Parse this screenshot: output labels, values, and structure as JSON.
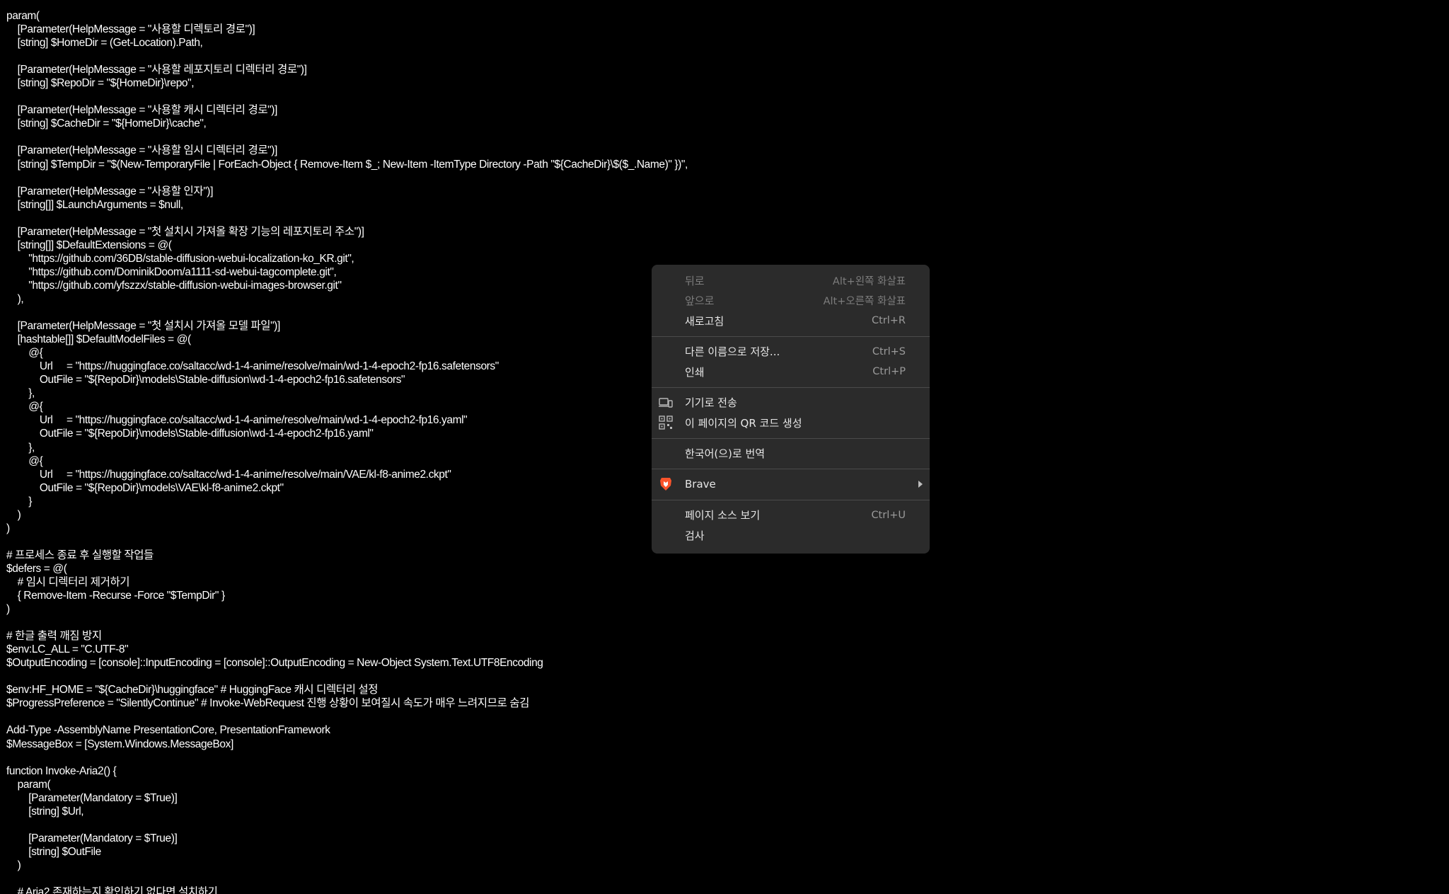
{
  "code_lines": [
    "param(",
    "    [Parameter(HelpMessage = \"사용할 디렉토리 경로\")]",
    "    [string] $HomeDir = (Get-Location).Path,",
    "",
    "    [Parameter(HelpMessage = \"사용할 레포지토리 디렉터리 경로\")]",
    "    [string] $RepoDir = \"${HomeDir}\\repo\",",
    "",
    "    [Parameter(HelpMessage = \"사용할 캐시 디렉터리 경로\")]",
    "    [string] $CacheDir = \"${HomeDir}\\cache\",",
    "",
    "    [Parameter(HelpMessage = \"사용할 임시 디렉터리 경로\")]",
    "    [string] $TempDir = \"$(New-TemporaryFile | ForEach-Object { Remove-Item $_; New-Item -ItemType Directory -Path \"${CacheDir}\\$($_.Name)\" })\",",
    "",
    "    [Parameter(HelpMessage = \"사용할 인자\")]",
    "    [string[]] $LaunchArguments = $null,",
    "",
    "    [Parameter(HelpMessage = \"첫 설치시 가져올 확장 기능의 레포지토리 주소\")]",
    "    [string[]] $DefaultExtensions = @(",
    "        \"https://github.com/36DB/stable-diffusion-webui-localization-ko_KR.git\",",
    "        \"https://github.com/DominikDoom/a1111-sd-webui-tagcomplete.git\",",
    "        \"https://github.com/yfszzx/stable-diffusion-webui-images-browser.git\"",
    "    ),",
    "",
    "    [Parameter(HelpMessage = \"첫 설치시 가져올 모델 파일\")]",
    "    [hashtable[]] $DefaultModelFiles = @(",
    "        @{",
    "            Url     = \"https://huggingface.co/saltacc/wd-1-4-anime/resolve/main/wd-1-4-epoch2-fp16.safetensors\"",
    "            OutFile = \"${RepoDir}\\models\\Stable-diffusion\\wd-1-4-epoch2-fp16.safetensors\"",
    "        },",
    "        @{",
    "            Url     = \"https://huggingface.co/saltacc/wd-1-4-anime/resolve/main/wd-1-4-epoch2-fp16.yaml\"",
    "            OutFile = \"${RepoDir}\\models\\Stable-diffusion\\wd-1-4-epoch2-fp16.yaml\"",
    "        },",
    "        @{",
    "            Url     = \"https://huggingface.co/saltacc/wd-1-4-anime/resolve/main/VAE/kl-f8-anime2.ckpt\"",
    "            OutFile = \"${RepoDir}\\models\\VAE\\kl-f8-anime2.ckpt\"",
    "        }",
    "    )",
    ")",
    "",
    "# 프로세스 종료 후 실행할 작업들",
    "$defers = @(",
    "    # 임시 디렉터리 제거하기",
    "    { Remove-Item -Recurse -Force \"$TempDir\" }",
    ")",
    "",
    "# 한글 출력 깨짐 방지",
    "$env:LC_ALL = \"C.UTF-8\"",
    "$OutputEncoding = [console]::InputEncoding = [console]::OutputEncoding = New-Object System.Text.UTF8Encoding",
    "",
    "$env:HF_HOME = \"${CacheDir}\\huggingface\" # HuggingFace 캐시 디렉터리 설정",
    "$ProgressPreference = \"SilentlyContinue\" # Invoke-WebRequest 진행 상황이 보여질시 속도가 매우 느려지므로 숨김",
    "",
    "Add-Type -AssemblyName PresentationCore, PresentationFramework",
    "$MessageBox = [System.Windows.MessageBox]",
    "",
    "function Invoke-Aria2() {",
    "    param(",
    "        [Parameter(Mandatory = $True)]",
    "        [string] $Url,",
    "",
    "        [Parameter(Mandatory = $True)]",
    "        [string] $OutFile",
    "    )",
    "",
    "    # Aria2 존재하는지 확인하기 없다면 설치하기"
  ],
  "menu": {
    "back": {
      "label": "뒤로",
      "shortcut": "Alt+왼쪽 화살표"
    },
    "forward": {
      "label": "앞으로",
      "shortcut": "Alt+오른쪽 화살표"
    },
    "reload": {
      "label": "새로고침",
      "shortcut": "Ctrl+R"
    },
    "save_as": {
      "label": "다른 이름으로 저장...",
      "shortcut": "Ctrl+S"
    },
    "print": {
      "label": "인쇄",
      "shortcut": "Ctrl+P"
    },
    "send_to_devices": {
      "label": "기기로 전송",
      "icon": "devices-icon"
    },
    "qr_code": {
      "label": "이 페이지의 QR 코드 생성",
      "icon": "qr-code-icon"
    },
    "translate": {
      "label": "한국어(으)로 번역"
    },
    "brave": {
      "label": "Brave",
      "icon": "brave-lion-icon"
    },
    "view_source": {
      "label": "페이지 소스 보기",
      "shortcut": "Ctrl+U"
    },
    "inspect": {
      "label": "검사"
    }
  },
  "colors": {
    "background": "#000000",
    "code_text": "#ffffff",
    "menu_bg": "#2b2b2b",
    "brave_orange": "#fb542b"
  }
}
